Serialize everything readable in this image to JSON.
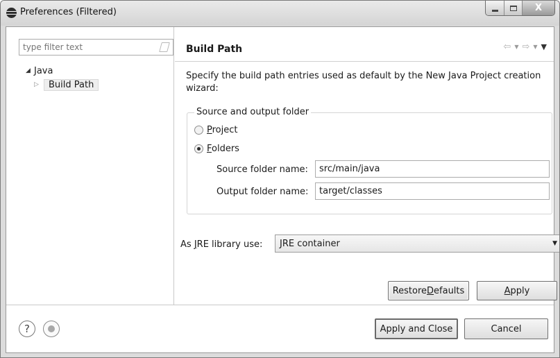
{
  "window": {
    "title": "Preferences (Filtered)",
    "minimize_label": "",
    "maximize_label": "",
    "close_label": "X"
  },
  "left": {
    "filter_placeholder": "type filter text",
    "tree": [
      {
        "label": "Java",
        "expanded": true
      },
      {
        "label": "Build Path",
        "selected": true
      }
    ]
  },
  "page": {
    "title": "Build Path",
    "description": "Specify the build path entries used as default by the New Java Project creation wizard:",
    "group_title": "Source and output folder",
    "radio_project": {
      "prefix": "",
      "mnemonic": "P",
      "rest": "roject",
      "checked": false
    },
    "radio_folders": {
      "prefix": "",
      "mnemonic": "F",
      "rest": "olders",
      "checked": true
    },
    "source_label": "Source folder name:",
    "source_value": "src/main/java",
    "output_label": "Output folder name:",
    "output_value": "target/classes",
    "jre_label_prefix": "As ",
    "jre_label_mnemonic": "J",
    "jre_label_rest": "RE library use:",
    "jre_selected": "JRE container",
    "restore_prefix": "Restore ",
    "restore_mnemonic": "D",
    "restore_rest": "efaults",
    "apply_mnemonic": "A",
    "apply_rest": "pply"
  },
  "footer": {
    "help_glyph": "?",
    "apply_close_label": "Apply and Close",
    "cancel_label": "Cancel"
  },
  "icons": {
    "app": "eclipse-icon",
    "help": "help-icon",
    "record": "record-icon",
    "back": "back-arrow-icon",
    "forward": "forward-arrow-icon",
    "menu": "view-menu-icon"
  }
}
